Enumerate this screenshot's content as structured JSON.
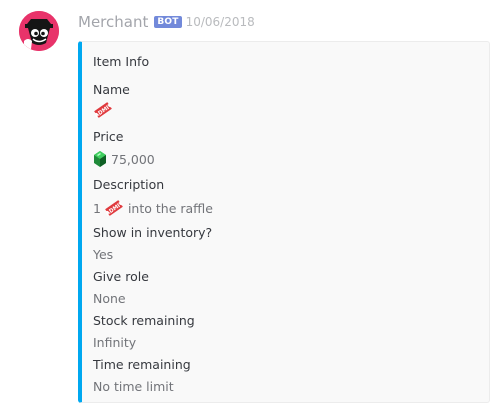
{
  "message": {
    "username": "Merchant",
    "bot_tag": "BOT",
    "timestamp": "10/06/2018"
  },
  "embed": {
    "title": "Item Info",
    "accent_color": "#00a8f0",
    "fields": {
      "name": {
        "label": "Name",
        "icon": "ticket-icon"
      },
      "price": {
        "label": "Price",
        "icon": "emerald-icon",
        "value": "75,000"
      },
      "description": {
        "label": "Description",
        "prefix": "1",
        "icon": "ticket-icon",
        "suffix": "into the raffle"
      },
      "show_in_inventory": {
        "label": "Show in inventory?",
        "value": "Yes"
      },
      "give_role": {
        "label": "Give role",
        "value": "None"
      },
      "stock_remaining": {
        "label": "Stock remaining",
        "value": "Infinity"
      },
      "time_remaining": {
        "label": "Time remaining",
        "value": "No time limit"
      }
    }
  },
  "colors": {
    "avatar_bg": "#e8336a",
    "bot_tag_bg": "#7289da",
    "ticket": "#e03a3e"
  }
}
